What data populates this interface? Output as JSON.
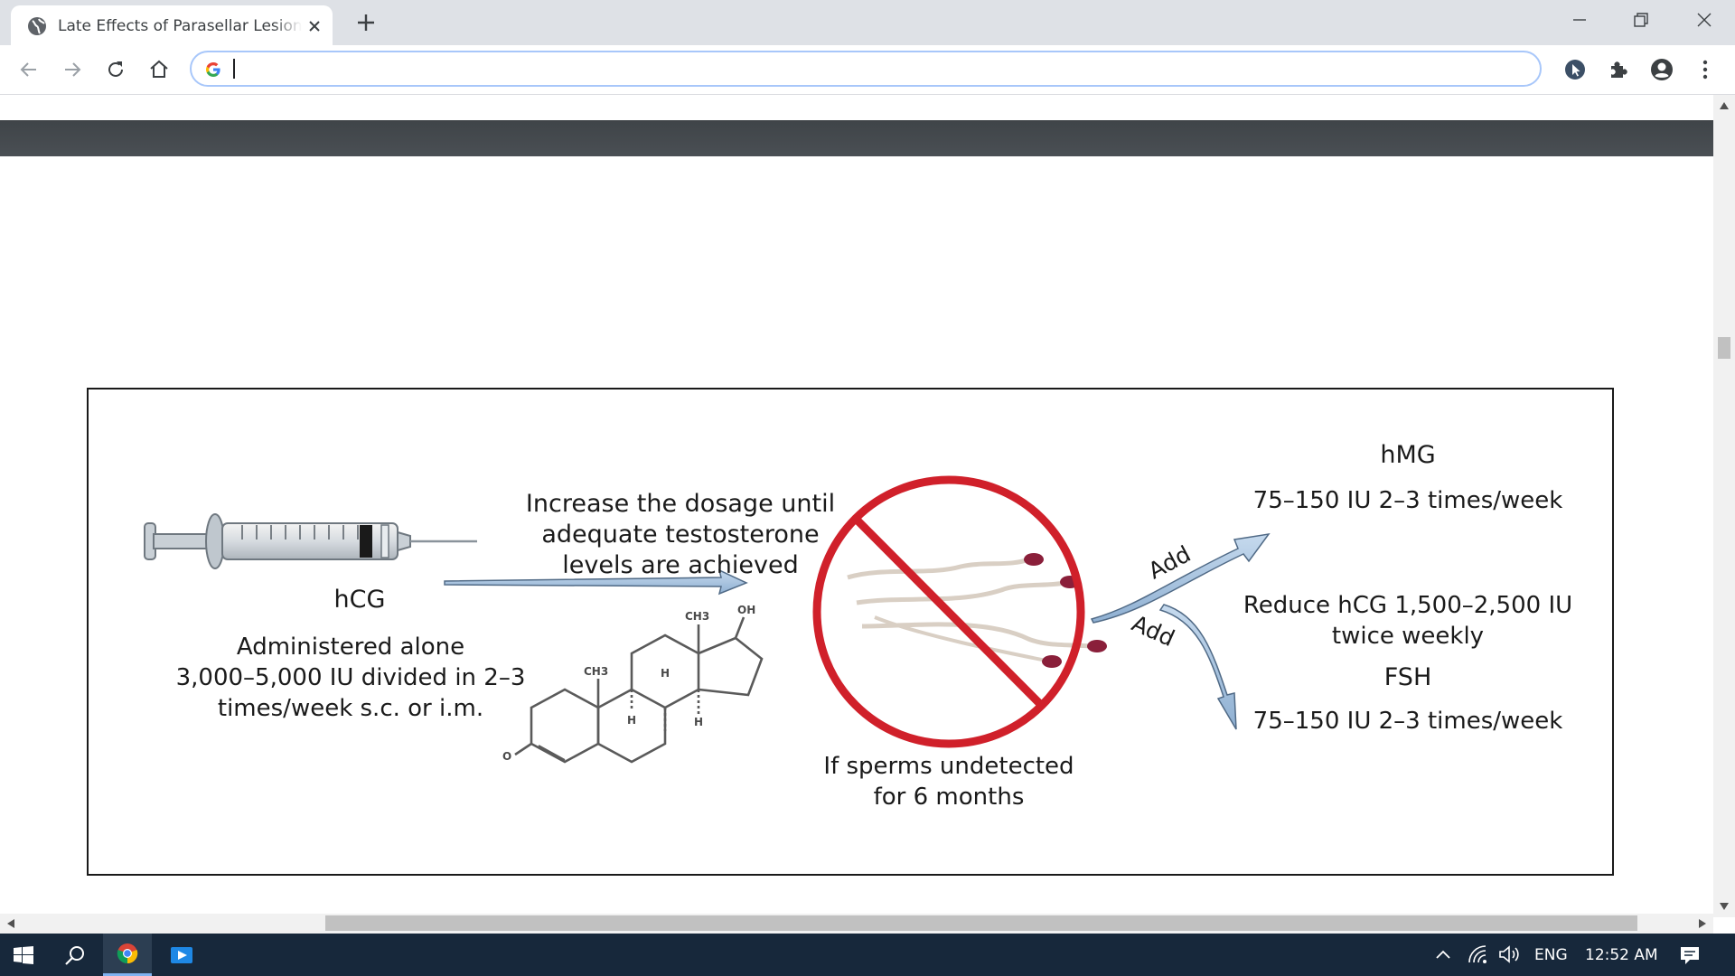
{
  "browser": {
    "tab_title": "Late Effects of Parasellar Lesion T",
    "address_value": "",
    "address_placeholder": ""
  },
  "figure": {
    "hcg_title": "hCG",
    "hcg_desc": "Administered alone\n3,000–5,000 IU divided in 2–3\ntimes/week s.c. or i.m.",
    "increase_text": "Increase the dosage until\nadequate testosterone\nlevels are achieved",
    "sperm_text": "If sperms undetected\nfor 6 months",
    "add_upper": "Add",
    "add_lower": "Add",
    "hmg_title": "hMG",
    "hmg_dose": "75–150 IU 2–3 times/week",
    "reduce_text": "Reduce hCG 1,500–2,500 IU\ntwice weekly",
    "fsh_title": "FSH",
    "fsh_dose": "75–150 IU 2–3 times/week",
    "molecule_labels": {
      "ch3_top": "CH3",
      "oh": "OH",
      "ch3_left": "CH3",
      "h1": "H",
      "h2": "H",
      "h3": "H",
      "o": "O"
    }
  },
  "taskbar": {
    "language": "ENG",
    "time": "12:52 AM"
  },
  "colors": {
    "tabstrip": "#dee1e6",
    "omnibox_border": "#a8c7fa",
    "page_bar": "#43484c",
    "prohibition_red": "#d0202a",
    "arrow_blue": "#a8c4e0",
    "taskbar": "#17283b"
  },
  "icons": [
    "globe-icon",
    "close-icon",
    "plus-icon",
    "minimize-icon",
    "restore-icon",
    "window-close-icon",
    "back-icon",
    "forward-icon",
    "reload-icon",
    "home-icon",
    "google-icon",
    "cursor-extension-icon",
    "puzzle-icon",
    "account-icon",
    "kebab-menu-icon",
    "windows-start-icon",
    "search-icon",
    "chrome-icon",
    "media-player-icon",
    "chevron-up-icon",
    "wifi-icon",
    "speaker-icon",
    "notification-icon"
  ]
}
